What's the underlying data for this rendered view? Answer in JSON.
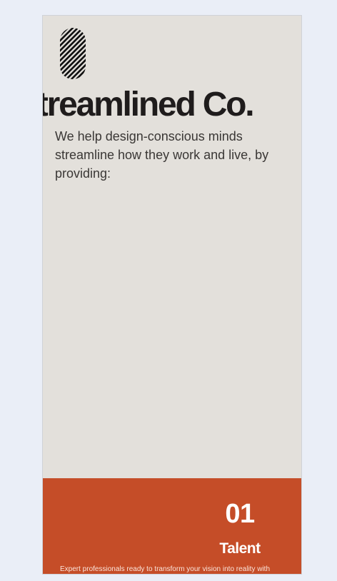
{
  "brand": {
    "name": "Streamlined Co.",
    "tagline": "We help design-conscious minds streamline how they work and live, by providing:",
    "logo_icon": "striped-s-logo-icon"
  },
  "services": [
    {
      "number": "01",
      "title": "Talent",
      "description": "Expert professionals ready to transform your vision into reality with"
    }
  ],
  "colors": {
    "page_background": "#eaeef7",
    "panel_background": "#e3e0db",
    "text_dark": "#1f1c1c",
    "accent": "#c54d28"
  }
}
